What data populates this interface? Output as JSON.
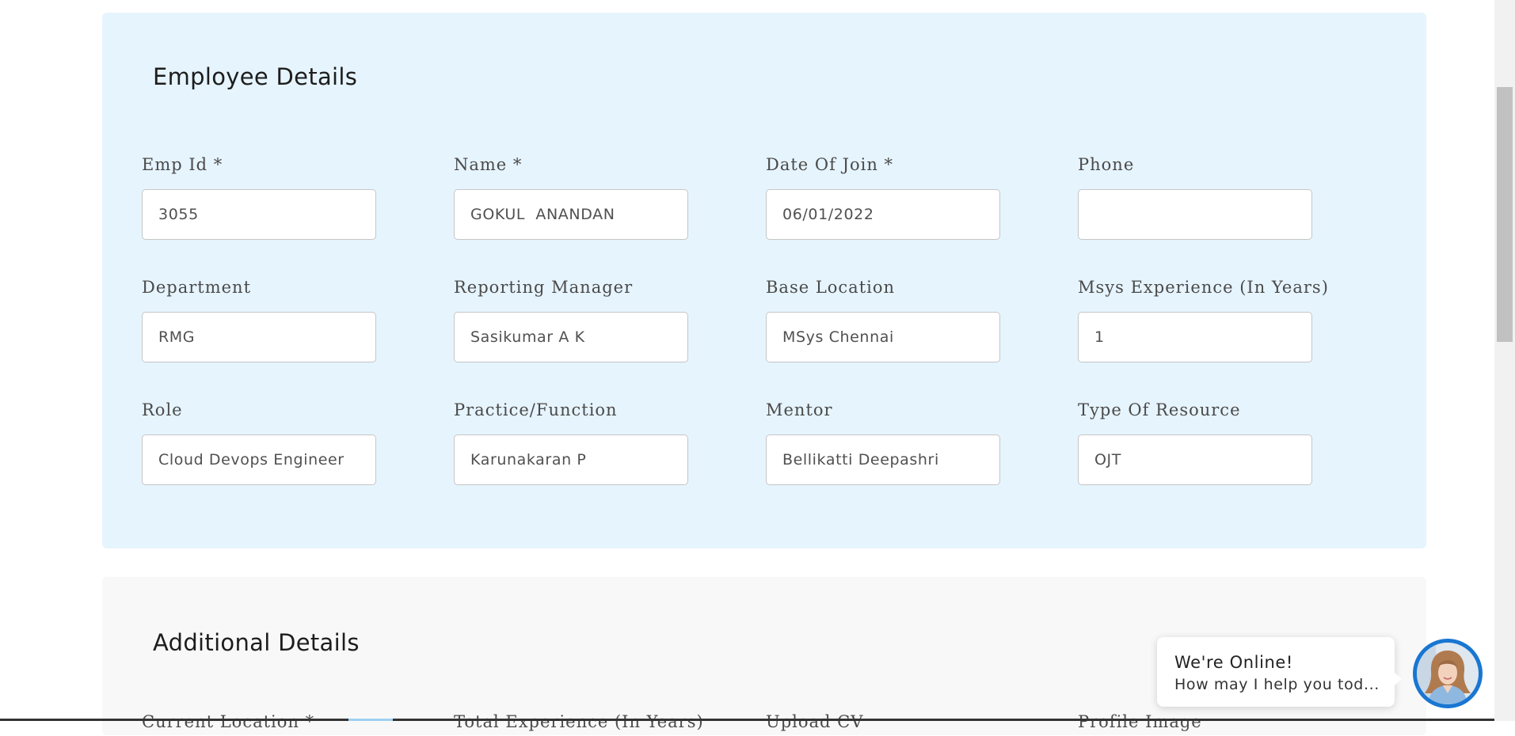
{
  "employee_details": {
    "title": "Employee Details",
    "fields": [
      {
        "label": "Emp Id *",
        "value": "3055"
      },
      {
        "label": "Name *",
        "value": "GOKUL  ANANDAN"
      },
      {
        "label": "Date Of Join *",
        "value": "06/01/2022"
      },
      {
        "label": "Phone",
        "value": ""
      },
      {
        "label": "Department",
        "value": "RMG"
      },
      {
        "label": "Reporting Manager",
        "value": "Sasikumar A K"
      },
      {
        "label": "Base Location",
        "value": "MSys Chennai"
      },
      {
        "label": "Msys Experience (In Years)",
        "value": "1"
      },
      {
        "label": "Role",
        "value": "Cloud Devops Engineer"
      },
      {
        "label": "Practice/Function",
        "value": "Karunakaran P"
      },
      {
        "label": "Mentor",
        "value": "Bellikatti Deepashri"
      },
      {
        "label": "Type Of Resource",
        "value": "OJT"
      }
    ]
  },
  "additional_details": {
    "title": "Additional Details",
    "fields": [
      {
        "label": "Current Location *"
      },
      {
        "label": "Total Experience (In Years)"
      },
      {
        "label": "Upload CV"
      },
      {
        "label": "Profile Image"
      }
    ]
  },
  "chat": {
    "status": "We're Online!",
    "message": "How may I help you tod..."
  },
  "colors": {
    "employee_card_bg": "#e6f4fd",
    "additional_card_bg": "#f8f8f8",
    "chat_avatar_ring": "#1976d2"
  }
}
